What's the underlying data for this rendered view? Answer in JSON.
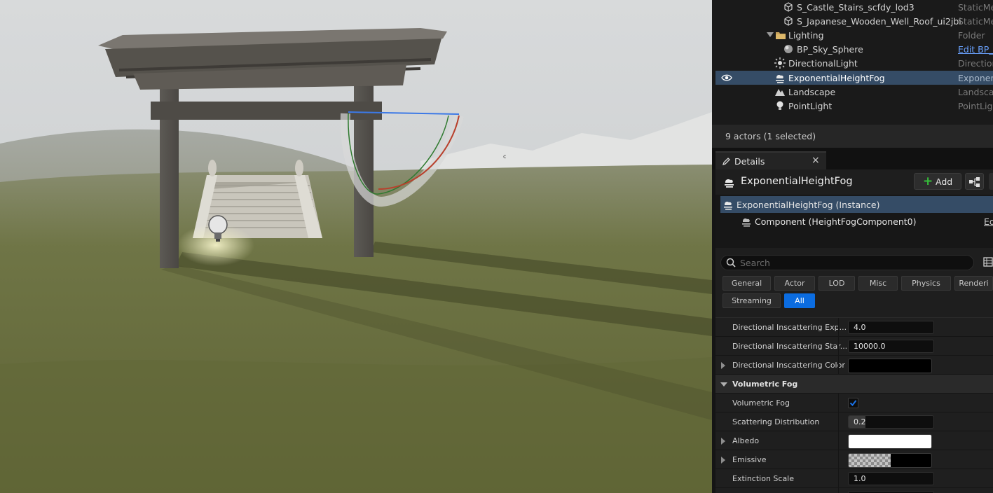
{
  "outliner": {
    "rows": [
      {
        "name": "S_Castle_Stairs_scfdy_lod3",
        "type": "StaticMe",
        "icon": "static-mesh-icon"
      },
      {
        "name": "S_Japanese_Wooden_Well_Roof_ui2jbi",
        "type": "StaticMe",
        "icon": "static-mesh-icon"
      },
      {
        "name": "Lighting",
        "type": "Folder",
        "icon": "folder-icon",
        "expanded": true
      },
      {
        "name": "BP_Sky_Sphere",
        "type": "Edit BP_S",
        "icon": "sky-sphere-icon"
      },
      {
        "name": "DirectionalLight",
        "type": "Direction",
        "icon": "directional-light-icon"
      },
      {
        "name": "ExponentialHeightFog",
        "type": "Exponen",
        "icon": "fog-icon",
        "selected": true
      },
      {
        "name": "Landscape",
        "type": "Landsca",
        "icon": "landscape-icon"
      },
      {
        "name": "PointLight",
        "type": "PointLigh",
        "icon": "point-light-icon"
      }
    ],
    "actor_count": "9 actors (1 selected)"
  },
  "details": {
    "tab_label": "Details",
    "tab_close": "×",
    "actor_name": "ExponentialHeightFog",
    "add_label": "Add",
    "components": [
      {
        "label": "ExponentialHeightFog (Instance)",
        "selected": true
      },
      {
        "label": "Component (HeightFogComponent0)",
        "edit": "Ed"
      }
    ],
    "search_placeholder": "Search",
    "filters": [
      "General",
      "Actor",
      "LOD",
      "Misc",
      "Physics",
      "Renderi",
      "Streaming",
      "All"
    ],
    "active_filter": "All",
    "properties": [
      {
        "label": "Directional Inscattering Exp...",
        "kind": "number",
        "value": "4.0"
      },
      {
        "label": "Directional Inscattering Star...",
        "kind": "number",
        "value": "10000.0"
      },
      {
        "label": "Directional Inscattering Color",
        "kind": "color",
        "expandable": true,
        "color": "#000000"
      },
      {
        "label": "Volumetric Fog",
        "kind": "category"
      },
      {
        "label": "Volumetric Fog",
        "kind": "checkbox",
        "checked": true
      },
      {
        "label": "Scattering Distribution",
        "kind": "slider",
        "value": "0.2",
        "fraction": 0.2
      },
      {
        "label": "Albedo",
        "kind": "color",
        "expandable": true,
        "color": "#ffffff"
      },
      {
        "label": "Emissive",
        "kind": "color",
        "expandable": true,
        "color": "#000000",
        "alpha_checker": true
      },
      {
        "label": "Extinction Scale",
        "kind": "slider",
        "value": "1.0",
        "fraction": 0.0
      }
    ]
  },
  "colors": {
    "selection": "#354c66",
    "accent": "#0b6ce0",
    "add_plus": "#36c13a",
    "link": "#6aa2ff"
  }
}
